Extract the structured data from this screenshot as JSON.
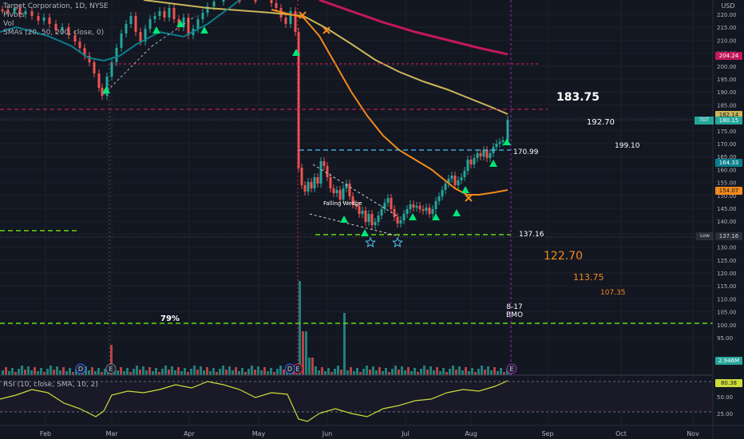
{
  "header": {
    "symbol_line": "Target Corporation, 1D, NYSE",
    "pivots_line": "Pivots",
    "vol_line": "Vol",
    "sma_line": "SMAs (20, 50, 200, close, 0)",
    "rsi_label": "RSI (10, close, SMA, 10, 2)"
  },
  "price_axis": {
    "currency": "USD",
    "ticks": [
      "220.00",
      "215.00",
      "210.00",
      "205.00",
      "200.00",
      "195.00",
      "190.00",
      "185.00",
      "180.00",
      "175.00",
      "170.00",
      "165.00",
      "160.00",
      "155.00",
      "150.00",
      "145.00",
      "140.00",
      "135.00",
      "130.00",
      "125.00",
      "120.00",
      "115.00",
      "110.00",
      "105.00",
      "100.00",
      "95.00"
    ],
    "labels": [
      {
        "text": "204.24",
        "color": "#c2185b"
      },
      {
        "text": "182.14",
        "color": "#cbb65a"
      },
      {
        "text": "180.15",
        "color": "#26a69a",
        "prefix": "TGT"
      },
      {
        "text": "164.33",
        "color": "#0b7e8e"
      },
      {
        "text": "154.07",
        "color": "#f28a1c"
      },
      {
        "text": "137.16",
        "color": "#2a2e39",
        "prefix": "Low"
      }
    ],
    "volume_label": "2.946M",
    "rsi_ticks": [
      "50.00",
      "25.00"
    ],
    "rsi_value": "80.38"
  },
  "time_axis": [
    "Feb",
    "Mar",
    "Apr",
    "May",
    "Jun",
    "Jul",
    "Aug",
    "Sep",
    "Oct",
    "Nov"
  ],
  "annotations": {
    "target_1": "183.75",
    "target_2": "192.70",
    "target_3": "199.10",
    "level_170": "170.99",
    "level_low": "137.16",
    "target_down_1": "122.70",
    "target_down_2": "113.75",
    "target_down_3": "107.35",
    "earnings_date": "8-17",
    "earnings_time": "BMO",
    "percent_label": "79%",
    "pattern_label": "Falling Wedge"
  },
  "markers": {
    "earnings_letter": "E",
    "dividend_letter": "D"
  },
  "colors": {
    "background": "#131722",
    "up_candle": "#26a69a",
    "down_candle": "#ef5350",
    "sma20": "#0b7e8e",
    "sma50": "#f28a1c",
    "sma200": "#c2185b",
    "sma_extra": "#cbb65a",
    "dashed_green": "#76ff03",
    "dashed_cyan": "#4fc3f7",
    "dashed_pink": "#e91e63",
    "rsi_line": "#cddc39"
  }
}
